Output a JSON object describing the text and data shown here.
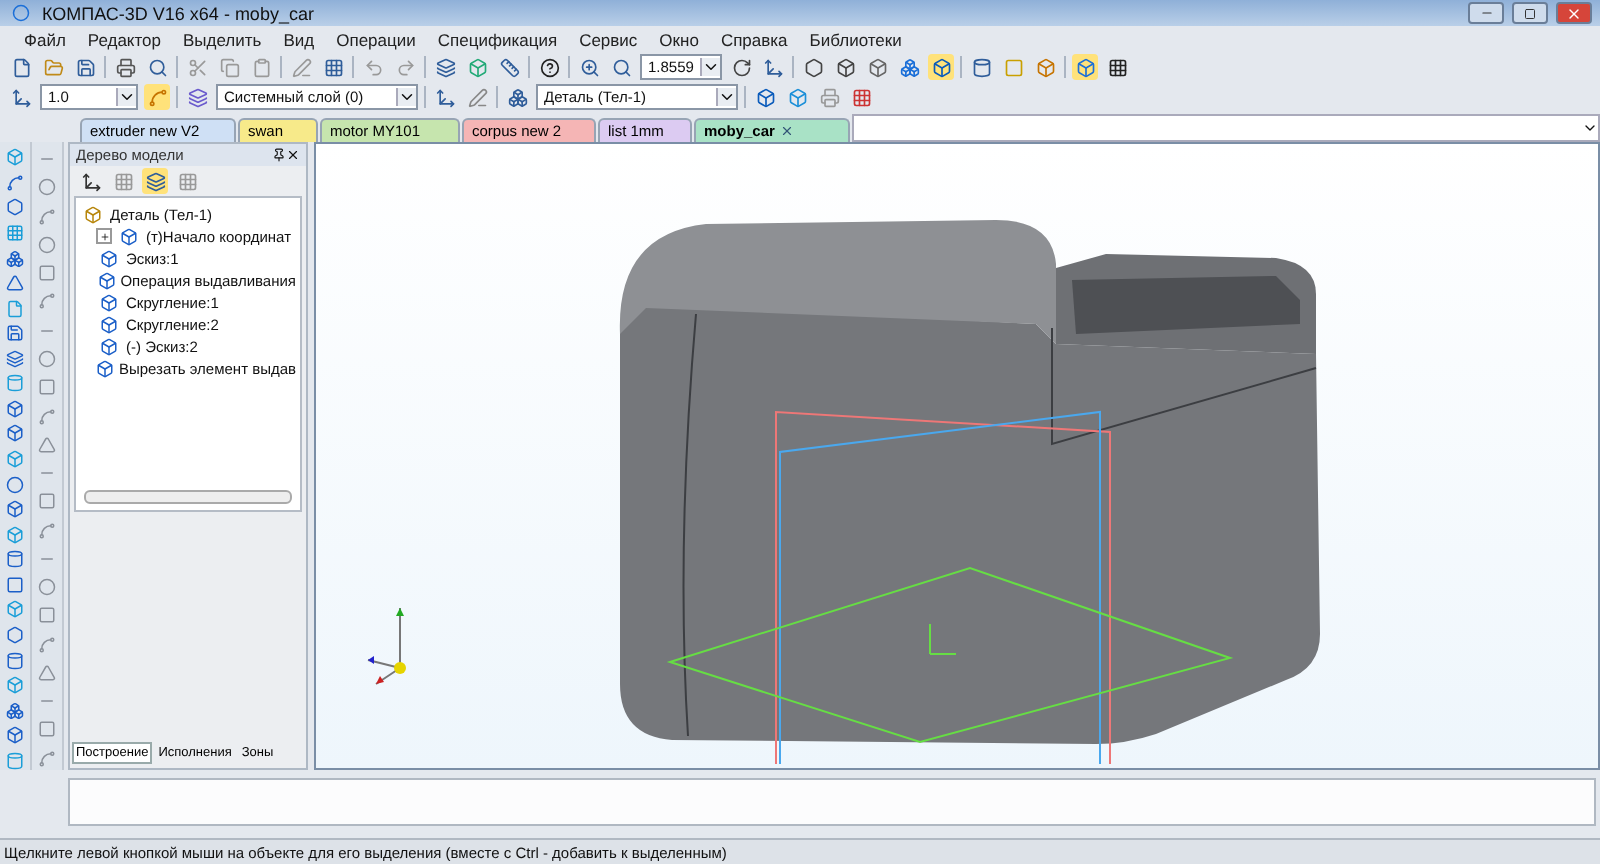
{
  "window": {
    "title": "КОМПАС-3D V16  x64 - moby_car"
  },
  "menu": [
    "Файл",
    "Редактор",
    "Выделить",
    "Вид",
    "Операции",
    "Спецификация",
    "Сервис",
    "Окно",
    "Справка",
    "Библиотеки"
  ],
  "toolbar": {
    "scale": "1.8559",
    "step": "1.0",
    "layer": "Системный слой (0)",
    "part": "Деталь (Тел-1)"
  },
  "doc_tabs": [
    {
      "label": "extruder new V2",
      "color": "#cfe0f5",
      "selected": false
    },
    {
      "label": "swan",
      "color": "#f7ea8a",
      "selected": false
    },
    {
      "label": "motor MY101",
      "color": "#c6e5ae",
      "selected": false
    },
    {
      "label": "corpus new 2",
      "color": "#f5b5b5",
      "selected": false
    },
    {
      "label": "list 1mm",
      "color": "#dccbf2",
      "selected": false
    },
    {
      "label": "moby_car",
      "color": "#a9e2c6",
      "selected": true
    }
  ],
  "tree_panel": {
    "title": "Дерево модели",
    "items": [
      {
        "label": "Деталь (Тел-1)",
        "children": [
          {
            "label": "(т)Начало координат",
            "expanded": false
          },
          {
            "label": "Эскиз:1"
          },
          {
            "label": "Операция выдавливания"
          },
          {
            "label": "Скругление:1"
          },
          {
            "label": "Скругление:2"
          },
          {
            "label": "(-) Эскиз:2"
          },
          {
            "label": "Вырезать элемент выдав"
          }
        ]
      }
    ],
    "bottom_tabs": [
      {
        "label": "Построение",
        "selected": true
      },
      {
        "label": "Исполнения",
        "selected": false
      },
      {
        "label": "Зоны",
        "selected": false
      }
    ]
  },
  "status_bar": "Щелкните левой кнопкой мыши на объекте для его выделения (вместе с Ctrl - добавить к выделенным)"
}
